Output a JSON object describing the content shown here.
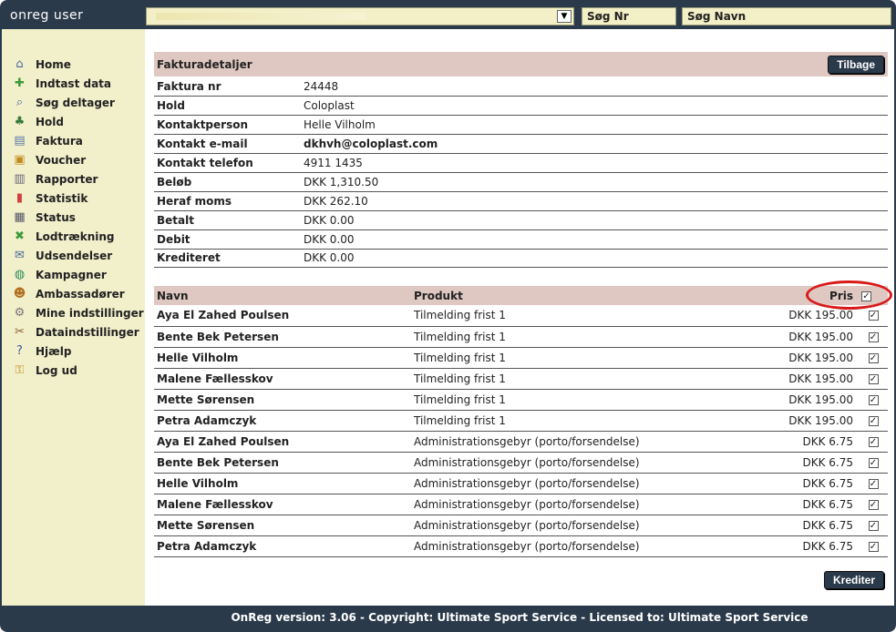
{
  "app": {
    "title": "onreg user"
  },
  "topbar": {
    "search_nr_label": "Søg Nr",
    "search_navn_label": "Søg Navn"
  },
  "sidebar": {
    "items": [
      {
        "label": "Home",
        "icon": "home-icon",
        "glyph": "⌂",
        "color": "#4a6a9a"
      },
      {
        "label": "Indtast data",
        "icon": "add-user-icon",
        "glyph": "✚",
        "color": "#3a9a3a"
      },
      {
        "label": "Søg deltager",
        "icon": "search-icon",
        "glyph": "⌕",
        "color": "#4a6a9a"
      },
      {
        "label": "Hold",
        "icon": "team-icon",
        "glyph": "♣",
        "color": "#3a7a3a"
      },
      {
        "label": "Faktura",
        "icon": "invoice-icon",
        "glyph": "▤",
        "color": "#5a7aa8"
      },
      {
        "label": "Voucher",
        "icon": "gift-icon",
        "glyph": "▣",
        "color": "#c08a20"
      },
      {
        "label": "Rapporter",
        "icon": "report-icon",
        "glyph": "▥",
        "color": "#667"
      },
      {
        "label": "Statistik",
        "icon": "chart-icon",
        "glyph": "▮",
        "color": "#d04040"
      },
      {
        "label": "Status",
        "icon": "status-icon",
        "glyph": "▦",
        "color": "#556"
      },
      {
        "label": "Lodtrækning",
        "icon": "shuffle-icon",
        "glyph": "✖",
        "color": "#3a9a3a"
      },
      {
        "label": "Udsendelser",
        "icon": "mail-icon",
        "glyph": "✉",
        "color": "#4a6a9a"
      },
      {
        "label": "Kampagner",
        "icon": "globe-icon",
        "glyph": "◍",
        "color": "#2a8a5a"
      },
      {
        "label": "Ambassadører",
        "icon": "people-icon",
        "glyph": "☻",
        "color": "#b07020"
      },
      {
        "label": "Mine indstillinger",
        "icon": "gear-icon",
        "glyph": "⚙",
        "color": "#777"
      },
      {
        "label": "Dataindstillinger",
        "icon": "tools-icon",
        "glyph": "✂",
        "color": "#8a5a30"
      },
      {
        "label": "Hjælp",
        "icon": "help-icon",
        "glyph": "?",
        "color": "#3a5a9a"
      },
      {
        "label": "Log ud",
        "icon": "lock-icon",
        "glyph": "⚿",
        "color": "#c09020"
      }
    ]
  },
  "invoice": {
    "title": "Fakturadetaljer",
    "back_label": "Tilbage",
    "rows": [
      {
        "key": "Faktura nr",
        "value": "24448"
      },
      {
        "key": "Hold",
        "value": "Coloplast"
      },
      {
        "key": "Kontaktperson",
        "value": "Helle Vilholm"
      },
      {
        "key": "Kontakt e-mail",
        "value": "dkhvh@coloplast.com"
      },
      {
        "key": "Kontakt telefon",
        "value": "4911 1435"
      },
      {
        "key": "Beløb",
        "value": "DKK 1,310.50"
      },
      {
        "key": "Heraf moms",
        "value": "DKK 262.10"
      },
      {
        "key": "Betalt",
        "value": "DKK 0.00"
      },
      {
        "key": "Debit",
        "value": "DKK 0.00"
      },
      {
        "key": "Krediteret",
        "value": "DKK 0.00"
      }
    ]
  },
  "lines": {
    "headers": {
      "name": "Navn",
      "product": "Produkt",
      "price": "Pris"
    },
    "rows": [
      {
        "name": "Aya El Zahed Poulsen",
        "product": "Tilmelding frist 1",
        "price": "DKK 195.00",
        "checked": true
      },
      {
        "name": "Bente Bek Petersen",
        "product": "Tilmelding frist 1",
        "price": "DKK 195.00",
        "checked": true
      },
      {
        "name": "Helle Vilholm",
        "product": "Tilmelding frist 1",
        "price": "DKK 195.00",
        "checked": true
      },
      {
        "name": "Malene Fællesskov",
        "product": "Tilmelding frist 1",
        "price": "DKK 195.00",
        "checked": true
      },
      {
        "name": "Mette Sørensen",
        "product": "Tilmelding frist 1",
        "price": "DKK 195.00",
        "checked": true
      },
      {
        "name": "Petra Adamczyk",
        "product": "Tilmelding frist 1",
        "price": "DKK 195.00",
        "checked": true
      },
      {
        "name": "Aya El Zahed Poulsen",
        "product": "Administrationsgebyr (porto/forsendelse)",
        "price": "DKK 6.75",
        "checked": true
      },
      {
        "name": "Bente Bek Petersen",
        "product": "Administrationsgebyr (porto/forsendelse)",
        "price": "DKK 6.75",
        "checked": true
      },
      {
        "name": "Helle Vilholm",
        "product": "Administrationsgebyr (porto/forsendelse)",
        "price": "DKK 6.75",
        "checked": true
      },
      {
        "name": "Malene Fællesskov",
        "product": "Administrationsgebyr (porto/forsendelse)",
        "price": "DKK 6.75",
        "checked": true
      },
      {
        "name": "Mette Sørensen",
        "product": "Administrationsgebyr (porto/forsendelse)",
        "price": "DKK 6.75",
        "checked": true
      },
      {
        "name": "Petra Adamczyk",
        "product": "Administrationsgebyr (porto/forsendelse)",
        "price": "DKK 6.75",
        "checked": true
      }
    ],
    "credit_label": "Krediter"
  },
  "footer": {
    "text": "OnReg version: 3.06 - Copyright: Ultimate Sport Service - Licensed to: Ultimate Sport Service"
  },
  "colors": {
    "header_bg": "#2b3a4a",
    "sidebar_bg": "#f2efcb",
    "table_header_bg": "#dfc8c2",
    "highlight": "#d81a1a"
  }
}
